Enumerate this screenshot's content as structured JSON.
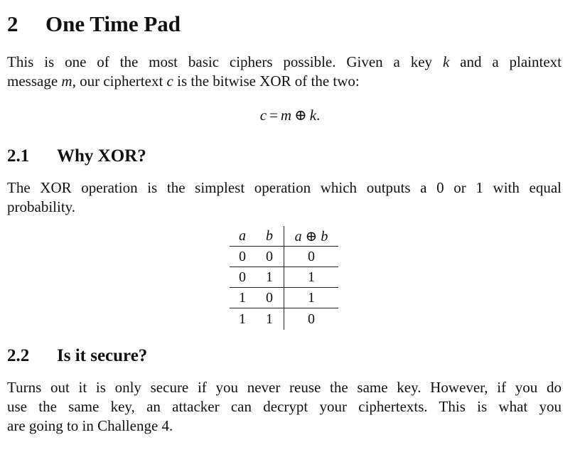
{
  "section": {
    "number": "2",
    "title": "One Time Pad"
  },
  "intro": {
    "line1_a": "This is one of the most basic ciphers possible. Given a key ",
    "line1_k": "k",
    "line1_b": " and a plaintext",
    "line2_a": "message ",
    "line2_m": "m",
    "line2_b": ", our ciphertext ",
    "line2_c": "c",
    "line2_d": " is the bitwise XOR of the two:"
  },
  "equation": {
    "lhs": "c",
    "eq": "=",
    "a": "m",
    "op": "⊕",
    "b": "k",
    "end": "."
  },
  "subsection_why": {
    "number": "2.1",
    "title": "Why XOR?"
  },
  "why_text": {
    "line1": "The XOR operation is the simplest operation which outputs a 0 or 1 with equal",
    "line2": "probability."
  },
  "truth_table": {
    "headers": [
      "a",
      "b",
      "a ⊕ b"
    ],
    "rows": [
      [
        "0",
        "0",
        "0"
      ],
      [
        "0",
        "1",
        "1"
      ],
      [
        "1",
        "0",
        "1"
      ],
      [
        "1",
        "1",
        "0"
      ]
    ]
  },
  "subsection_secure": {
    "number": "2.2",
    "title": "Is it secure?"
  },
  "secure_text": {
    "line1": "Turns out it is only secure if you never reuse the same key. However, if you do",
    "line2": "use the same key, an attacker can decrypt your ciphertexts. This is what you",
    "line3": "are going to in Challenge 4."
  }
}
